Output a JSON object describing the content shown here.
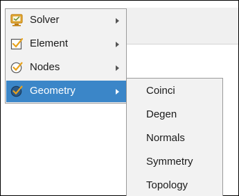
{
  "menu": {
    "items": [
      {
        "label": "Solver",
        "icon": "solver-monitor-icon",
        "has_submenu": true,
        "active": false
      },
      {
        "label": "Element",
        "icon": "element-checkbox-icon",
        "has_submenu": true,
        "active": false
      },
      {
        "label": "Nodes",
        "icon": "nodes-check-circle-icon",
        "has_submenu": true,
        "active": false
      },
      {
        "label": "Geometry",
        "icon": "geometry-check-circle-icon",
        "has_submenu": true,
        "active": true
      }
    ]
  },
  "submenu": {
    "items": [
      {
        "label": "Coinci"
      },
      {
        "label": "Degen"
      },
      {
        "label": "Normals"
      },
      {
        "label": "Symmetry"
      },
      {
        "label": "Topology"
      }
    ]
  },
  "colors": {
    "highlight": "#3b86c8",
    "icon_orange": "#e8a21c",
    "menu_bg": "#f2f2f2"
  }
}
